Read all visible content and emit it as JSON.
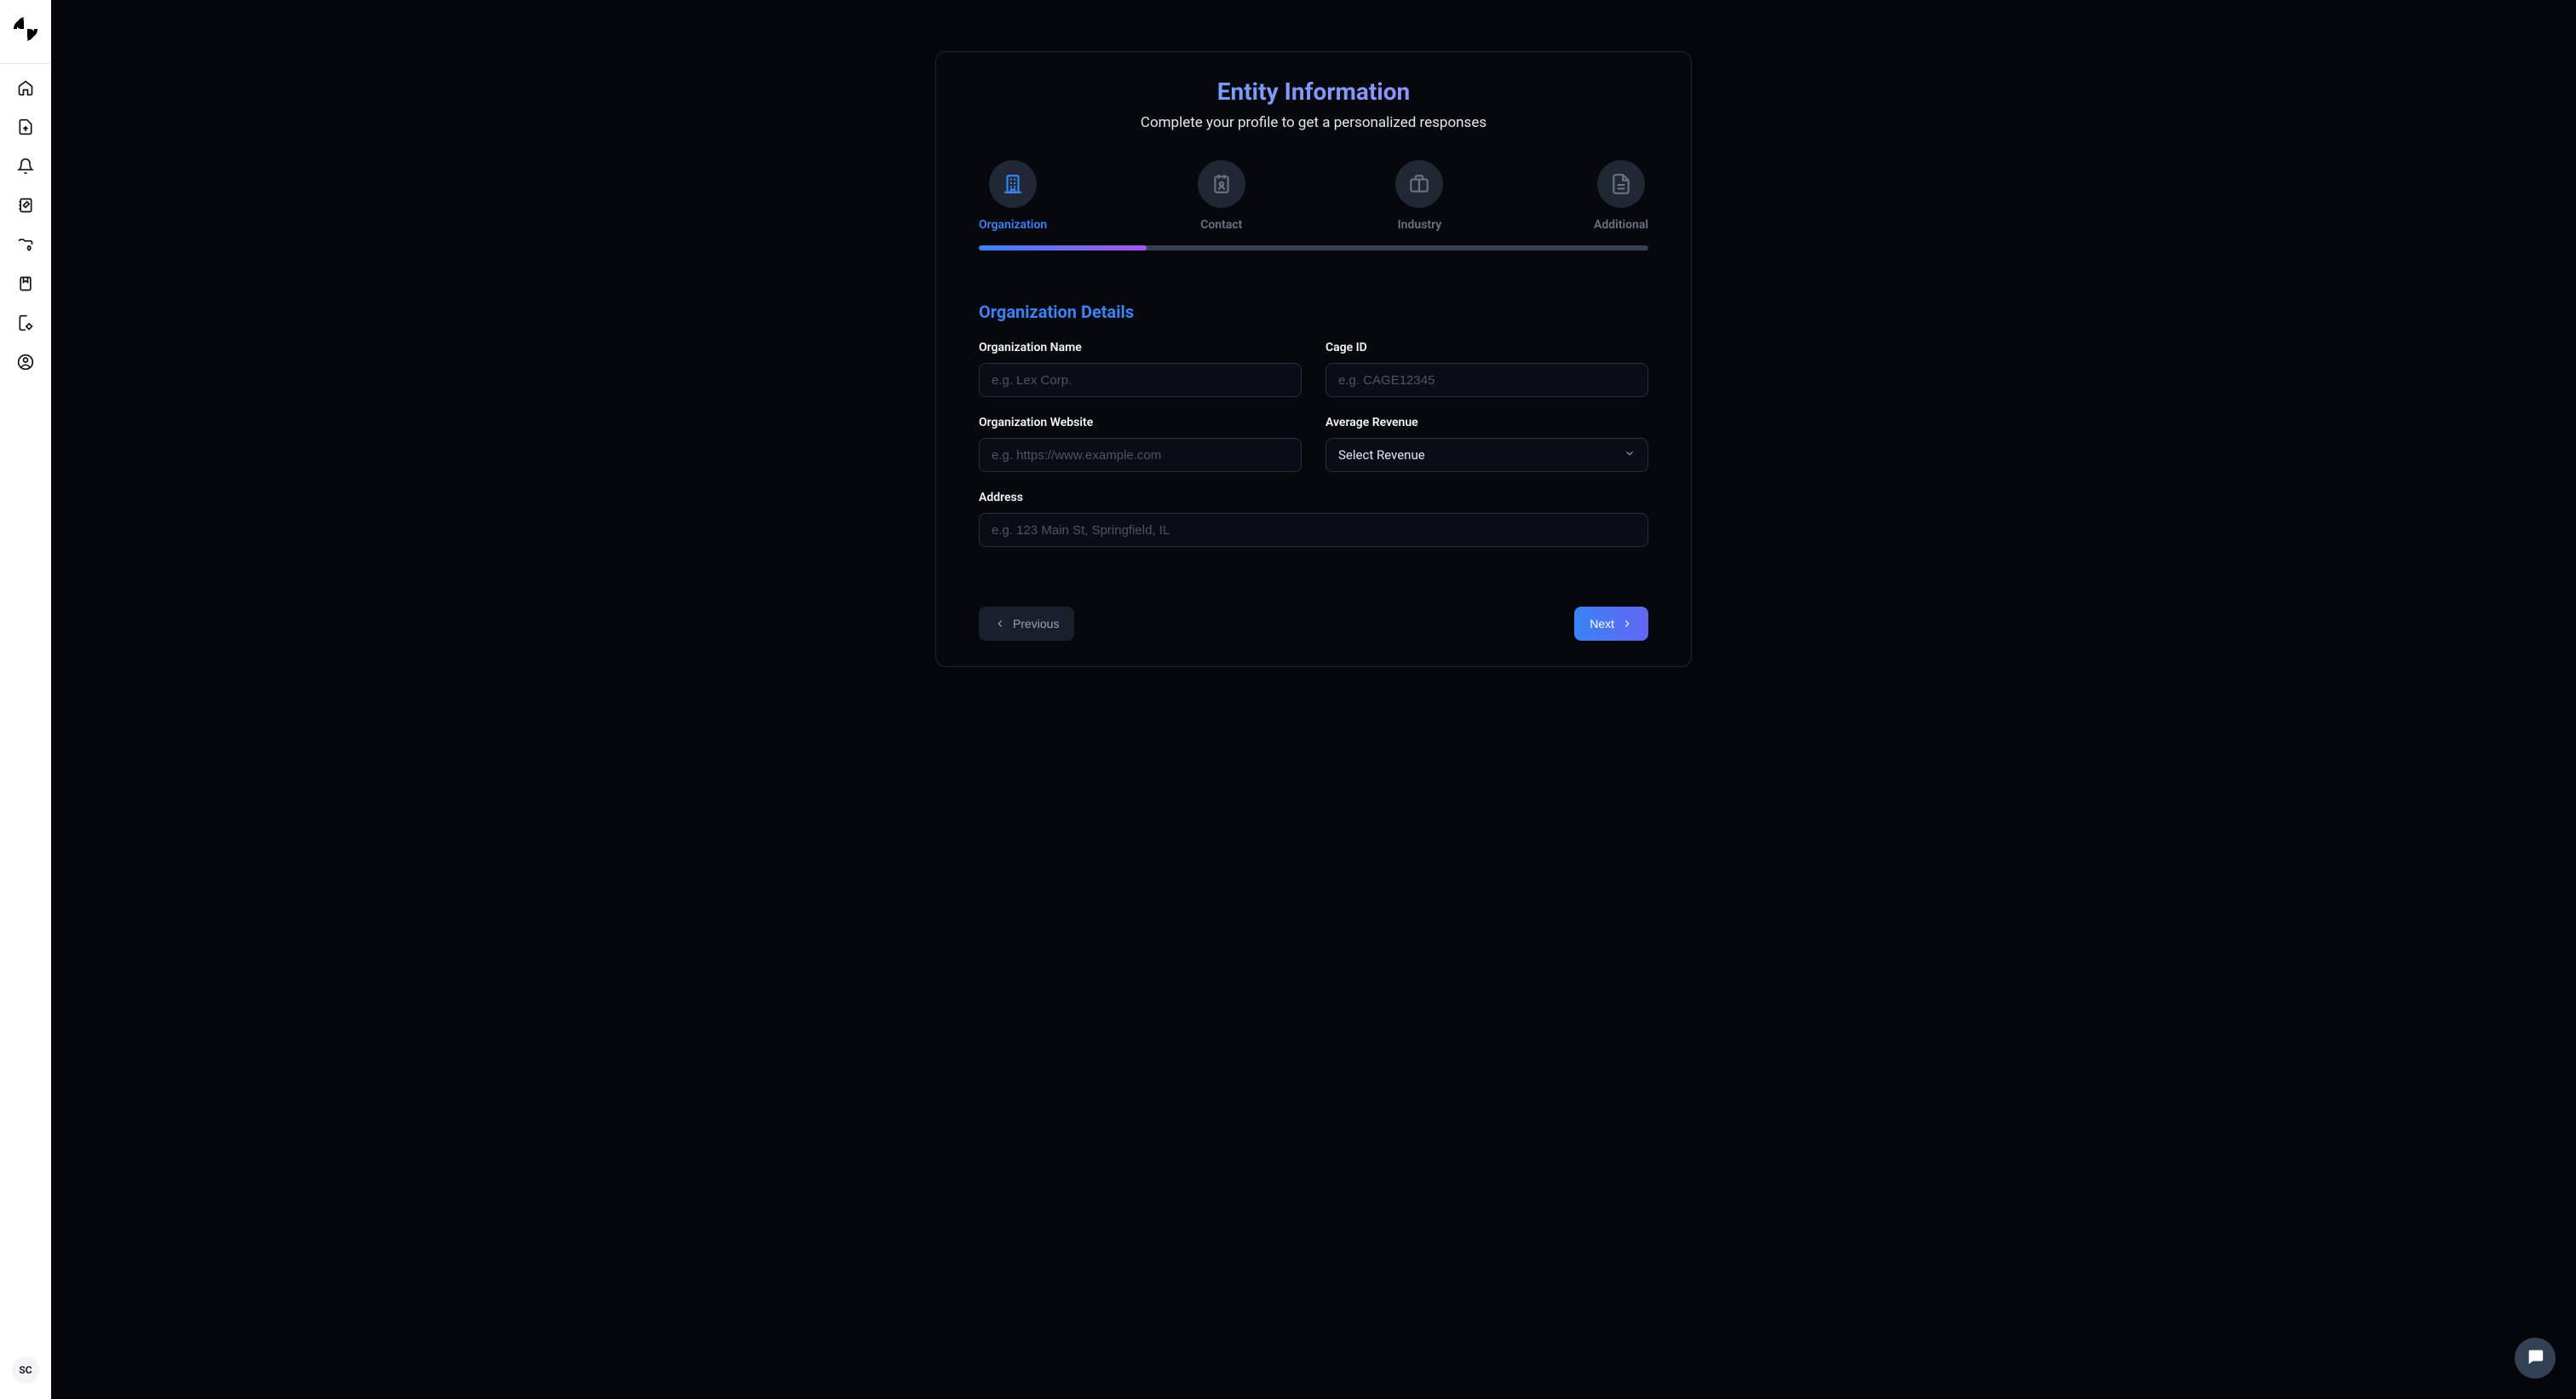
{
  "sidebar": {
    "avatar_initials": "SC"
  },
  "page": {
    "title": "Entity Information",
    "subtitle": "Complete your profile to get a personalized responses"
  },
  "steps": [
    {
      "label": "Organization",
      "active": true
    },
    {
      "label": "Contact",
      "active": false
    },
    {
      "label": "Industry",
      "active": false
    },
    {
      "label": "Additional",
      "active": false
    }
  ],
  "progress_percent": 25,
  "section": {
    "title": "Organization Details"
  },
  "fields": {
    "org_name": {
      "label": "Organization Name",
      "placeholder": "e.g. Lex Corp.",
      "value": ""
    },
    "cage_id": {
      "label": "Cage ID",
      "placeholder": "e.g. CAGE12345",
      "value": ""
    },
    "website": {
      "label": "Organization Website",
      "placeholder": "e.g. https://www.example.com",
      "value": ""
    },
    "revenue": {
      "label": "Average Revenue",
      "selected": "Select Revenue"
    },
    "address": {
      "label": "Address",
      "placeholder": "e.g. 123 Main St, Springfield, IL",
      "value": ""
    }
  },
  "nav": {
    "previous": "Previous",
    "next": "Next"
  }
}
